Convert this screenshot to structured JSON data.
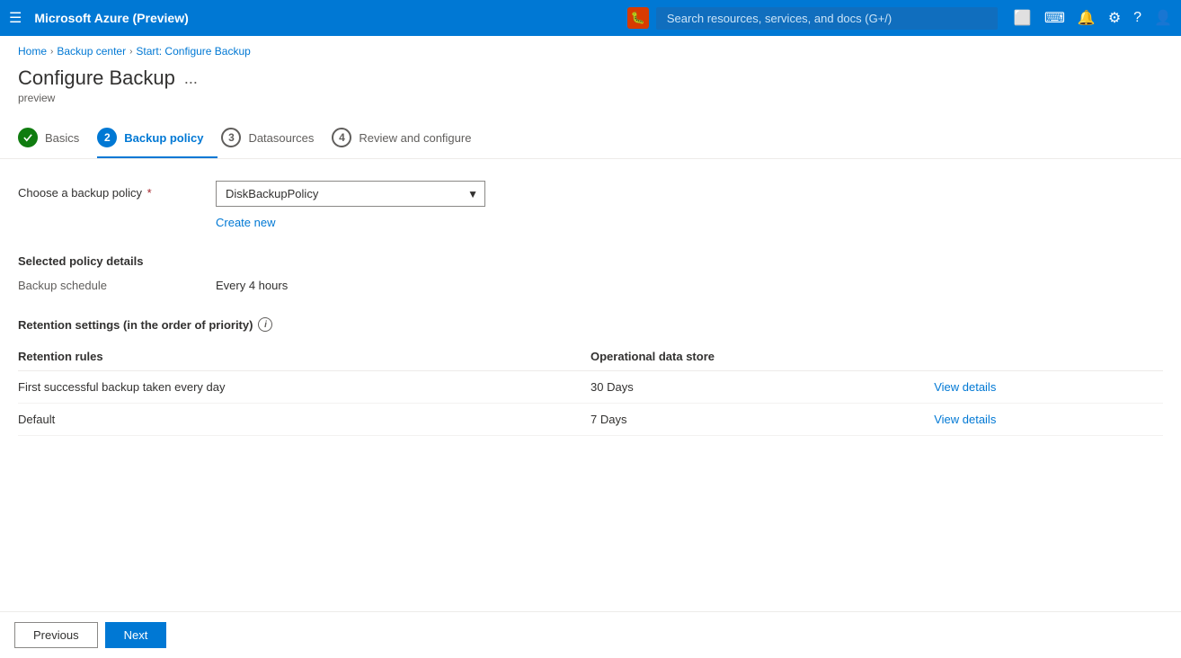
{
  "topnav": {
    "title": "Microsoft Azure (Preview)",
    "search_placeholder": "Search resources, services, and docs (G+/)"
  },
  "breadcrumb": {
    "items": [
      "Home",
      "Backup center",
      "Start: Configure Backup"
    ]
  },
  "page": {
    "title": "Configure Backup",
    "subtitle": "preview",
    "more_label": "..."
  },
  "tabs": [
    {
      "id": "basics",
      "number": "✓",
      "label": "Basics",
      "state": "completed"
    },
    {
      "id": "backup-policy",
      "number": "2",
      "label": "Backup policy",
      "state": "active"
    },
    {
      "id": "datasources",
      "number": "3",
      "label": "Datasources",
      "state": "inactive"
    },
    {
      "id": "review",
      "number": "4",
      "label": "Review and configure",
      "state": "inactive"
    }
  ],
  "form": {
    "backup_policy_label": "Choose a backup policy",
    "backup_policy_value": "DiskBackupPolicy",
    "backup_policy_options": [
      "DiskBackupPolicy"
    ],
    "create_new_label": "Create new"
  },
  "policy_details": {
    "section_title": "Selected policy details",
    "backup_schedule_label": "Backup schedule",
    "backup_schedule_value": "Every 4 hours"
  },
  "retention": {
    "section_title": "Retention settings (in the order of priority)",
    "columns": [
      "Retention rules",
      "Operational data store"
    ],
    "rows": [
      {
        "rule": "First successful backup taken every day",
        "data_store": "30 Days",
        "action_label": "View details"
      },
      {
        "rule": "Default",
        "data_store": "7 Days",
        "action_label": "View details"
      }
    ]
  },
  "footer": {
    "previous_label": "Previous",
    "next_label": "Next"
  }
}
